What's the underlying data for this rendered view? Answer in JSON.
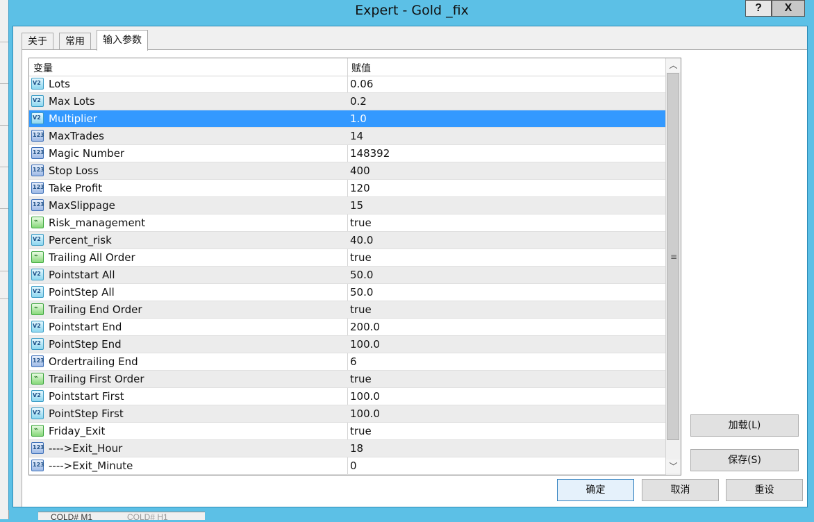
{
  "window": {
    "title": "Expert - Gold _fix",
    "help_button": "?",
    "close_button": "X"
  },
  "tabs": [
    {
      "label": "关于"
    },
    {
      "label": "常用"
    },
    {
      "label": "输入参数",
      "active": true
    }
  ],
  "table": {
    "headers": {
      "variable": "变量",
      "value": "赋值"
    },
    "rows": [
      {
        "icon": "double-icon",
        "name": "Lots",
        "value": "0.06"
      },
      {
        "icon": "double-icon",
        "name": "Max Lots",
        "value": "0.2"
      },
      {
        "icon": "double-icon",
        "name": "Multiplier",
        "value": "1.0",
        "selected": true
      },
      {
        "icon": "integer-icon",
        "name": "MaxTrades",
        "value": "14"
      },
      {
        "icon": "integer-icon",
        "name": "Magic Number",
        "value": "148392"
      },
      {
        "icon": "integer-icon",
        "name": "Stop Loss",
        "value": "400"
      },
      {
        "icon": "integer-icon",
        "name": "Take Profit",
        "value": "120"
      },
      {
        "icon": "integer-icon",
        "name": "MaxSlippage",
        "value": "15"
      },
      {
        "icon": "boolean-icon",
        "name": "Risk_management",
        "value": "true"
      },
      {
        "icon": "double-icon",
        "name": "Percent_risk",
        "value": "40.0"
      },
      {
        "icon": "boolean-icon",
        "name": "Trailing All Order",
        "value": "true"
      },
      {
        "icon": "double-icon",
        "name": "Pointstart All",
        "value": "50.0"
      },
      {
        "icon": "double-icon",
        "name": "PointStep All",
        "value": "50.0"
      },
      {
        "icon": "boolean-icon",
        "name": "Trailing End Order",
        "value": "true"
      },
      {
        "icon": "double-icon",
        "name": "Pointstart End",
        "value": "200.0"
      },
      {
        "icon": "double-icon",
        "name": "PointStep End",
        "value": "100.0"
      },
      {
        "icon": "integer-icon",
        "name": "Ordertrailing End",
        "value": "6"
      },
      {
        "icon": "boolean-icon",
        "name": "Trailing First Order",
        "value": "true"
      },
      {
        "icon": "double-icon",
        "name": "Pointstart First",
        "value": "100.0"
      },
      {
        "icon": "double-icon",
        "name": "PointStep First",
        "value": "100.0"
      },
      {
        "icon": "boolean-icon",
        "name": "Friday_Exit",
        "value": "true"
      },
      {
        "icon": "integer-icon",
        "name": "---->Exit_Hour",
        "value": "18"
      },
      {
        "icon": "integer-icon",
        "name": "---->Exit_Minute",
        "value": "0"
      }
    ]
  },
  "icon_glyphs": {
    "double": "V2",
    "integer": "123",
    "boolean": "⌁"
  },
  "side_buttons": {
    "load": "加载(L)",
    "save": "保存(S)"
  },
  "bottom_buttons": {
    "ok": "确定",
    "cancel": "取消",
    "reset": "重设"
  },
  "background_tabs": [
    "COLD# M1",
    "COLD# H1"
  ],
  "colors": {
    "selection": "#3399ff",
    "title_bar": "#5cc0e6"
  }
}
